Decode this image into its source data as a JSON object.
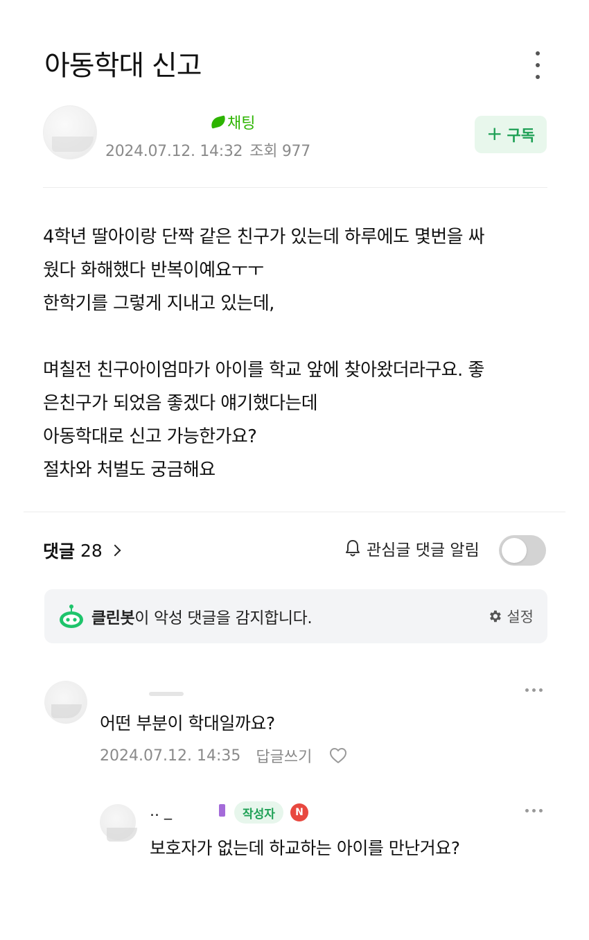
{
  "post": {
    "title": "아동학대 신고",
    "author_level": "채팅",
    "date": "2024.07.12. 14:32",
    "views": "조회 977",
    "subscribe_label": "구독",
    "subscribe_plus": "+",
    "body": [
      "4학년 딸아이랑 단짝 같은 친구가 있는데 하루에도 몇번을 싸",
      "웠다 화해했다 반복이예요ㅜㅜ",
      "한학기를 그렇게 지내고 있는데,",
      "",
      "며칠전 친구아이엄마가 아이를 학교 앞에 찾아왔더라구요. 좋",
      "은친구가 되었음 좋겠다 얘기했다는데",
      "아동학대로 신고 가능한가요?",
      "절차와 처벌도 궁금해요"
    ]
  },
  "comments_header": {
    "label": "댓글",
    "count": "28",
    "alarm_label": "관심글 댓글 알림",
    "alarm_on": false
  },
  "cleanbot": {
    "name": "클린봇",
    "message": "이 악성 댓글을 감지합니다.",
    "settings_label": "설정"
  },
  "comments": [
    {
      "text": "어떤 부분이 학대일까요?",
      "date": "2024.07.12. 14:35",
      "reply_label": "답글쓰기"
    },
    {
      "name": ".. _",
      "author_badge": "작성자",
      "new_badge": "N",
      "text": "보호자가 없는데 하교하는 아이를 만난거요?"
    }
  ],
  "colors": {
    "accent_green": "#1ea055",
    "level_green": "#2db400",
    "new_badge_red": "#e8483f",
    "meta_gray": "#8a8a8a"
  }
}
